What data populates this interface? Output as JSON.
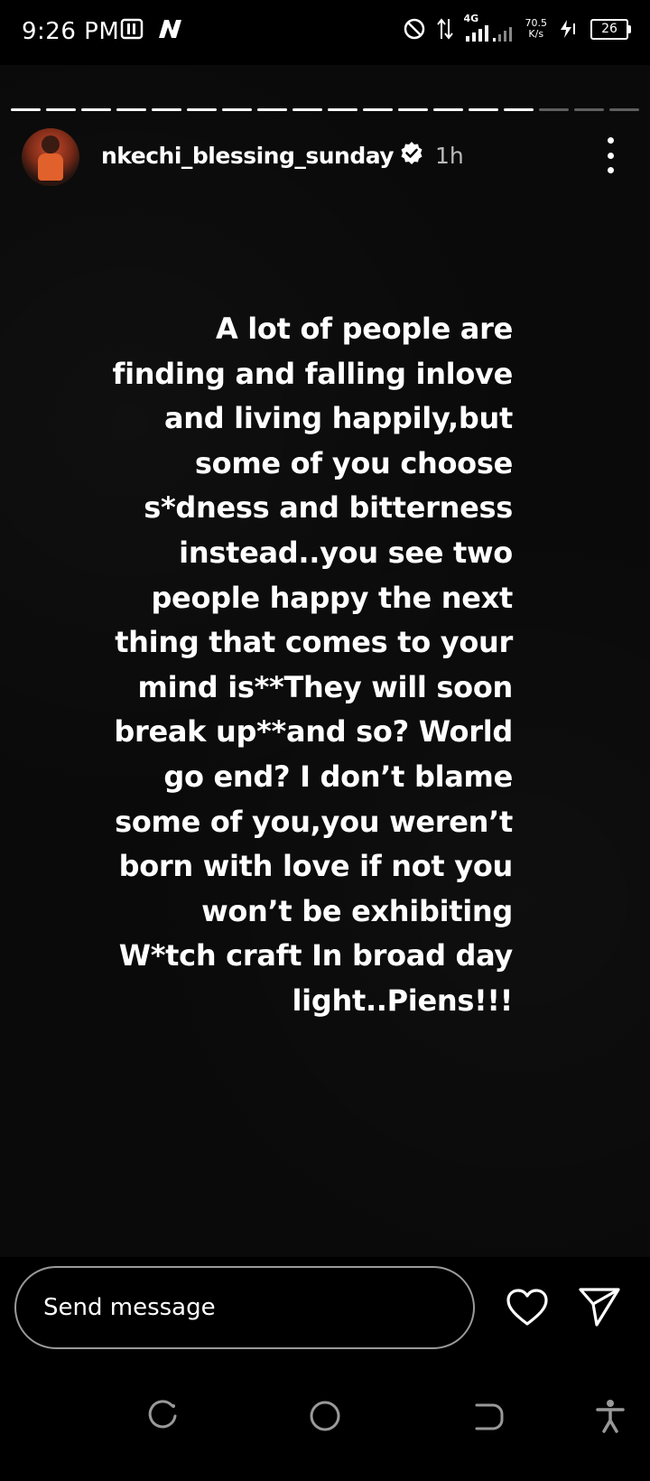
{
  "status_bar": {
    "time": "9:26 PM",
    "network_type": "4G",
    "net_speed_value": "70.5",
    "net_speed_unit": "K/s",
    "battery_level": "26",
    "icons": [
      "sim-pill-icon",
      "n-app-icon",
      "do-not-disturb-icon",
      "data-arrows-icon",
      "signal-icon",
      "wifi-signal-icon",
      "charging-icon",
      "battery-icon"
    ]
  },
  "story": {
    "progress": {
      "total_segments": 18,
      "viewed_segments": 15
    },
    "username": "nkechi_blessing_sunday",
    "verified": true,
    "time_ago": "1h",
    "text": "A lot of people are\nfinding and falling inlove\nand living happily,but\nsome of you choose\ns*dness and bitterness\ninstead..you see two\npeople happy the next\nthing that comes to your\nmind is**They will soon\nbreak up**and so? World\ngo end? I don’t blame\nsome of you,you weren’t\nborn with love if not you\nwon’t be exhibiting\nW*tch craft In broad day\nlight..Piens!!!"
  },
  "reply": {
    "placeholder": "Send message",
    "like_icon": "heart-icon",
    "share_icon": "send-icon"
  },
  "nav": {
    "icons": [
      "recents-icon",
      "home-icon",
      "back-icon",
      "accessibility-icon"
    ]
  },
  "colors": {
    "background": "#000000",
    "text": "#ffffff",
    "muted": "#bbbbbb",
    "input_border": "#9a9a9a"
  }
}
